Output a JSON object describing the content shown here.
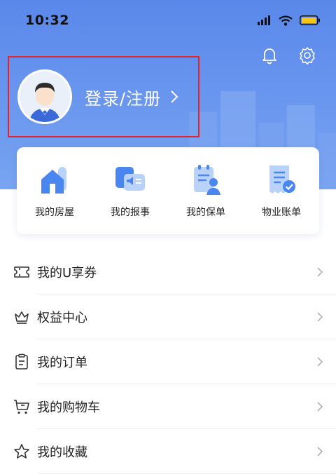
{
  "status_bar": {
    "time": "10:32"
  },
  "profile": {
    "login_label": "登录/注册"
  },
  "shortcuts": [
    {
      "label": "我的房屋",
      "icon": "house-icon"
    },
    {
      "label": "我的报事",
      "icon": "report-icon"
    },
    {
      "label": "我的保单",
      "icon": "policy-icon"
    },
    {
      "label": "物业账单",
      "icon": "bill-icon"
    }
  ],
  "menu": [
    {
      "label": "我的U享券",
      "icon": "coupon-icon"
    },
    {
      "label": "权益中心",
      "icon": "crown-icon"
    },
    {
      "label": "我的订单",
      "icon": "order-icon"
    },
    {
      "label": "我的购物车",
      "icon": "cart-icon"
    },
    {
      "label": "我的收藏",
      "icon": "star-icon"
    }
  ],
  "colors": {
    "header_blue": "#5a88ea",
    "highlight_red": "#e1252e",
    "icon_blue": "#4a86f0"
  }
}
